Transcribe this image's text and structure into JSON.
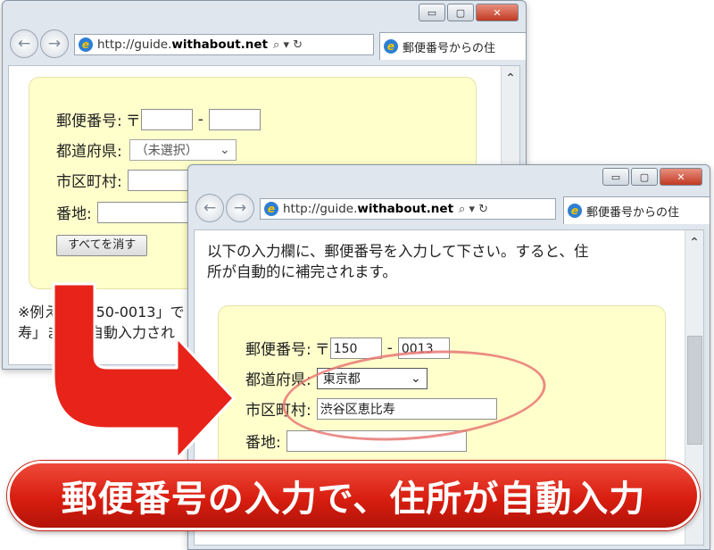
{
  "window_back": {
    "controls": [
      "▭",
      "▢",
      "✕"
    ],
    "url_prefix": "http://guide.",
    "url_domain": "withabout.net",
    "url_tools": "⌕ ▾ ↻",
    "tab_label": "郵便番号からの住",
    "form": {
      "zip_label": "郵便番号:",
      "zip_mark": "〒",
      "zip_dash": "-",
      "zip1_value": "",
      "zip2_value": "",
      "pref_label": "都道府県:",
      "pref_value": "（未選択）",
      "city_label": "市区町村:",
      "city_value": "",
      "addr_label": "番地:",
      "addr_value": "",
      "clear_button": "すべてを消す"
    },
    "note_line1": "※例えば「150-0013」で",
    "note_line2": "寿」までが自動入力され"
  },
  "window_front": {
    "controls": [
      "▭",
      "▢",
      "✕"
    ],
    "url_prefix": "http://guide.",
    "url_domain": "withabout.net",
    "url_tools": "⌕ ▾ ↻",
    "tab_label": "郵便番号からの住",
    "intro_line1": "以下の入力欄に、郵便番号を入力して下さい。すると、住",
    "intro_line2": "所が自動的に補完されます。",
    "form": {
      "zip_label": "郵便番号:",
      "zip_mark": "〒",
      "zip_dash": "-",
      "zip1_value": "150",
      "zip2_value": "0013",
      "pref_label": "都道府県:",
      "pref_value": "東京都",
      "city_label": "市区町村:",
      "city_value": "渋谷区恵比寿",
      "addr_label": "番地:",
      "addr_value": ""
    }
  },
  "banner_text": "郵便番号の入力で、住所が自動入力",
  "colors": {
    "arrow": "#e8231a",
    "banner": "#d81e10",
    "form_bg": "#ffffcc",
    "highlight_oval": "#e87874"
  }
}
